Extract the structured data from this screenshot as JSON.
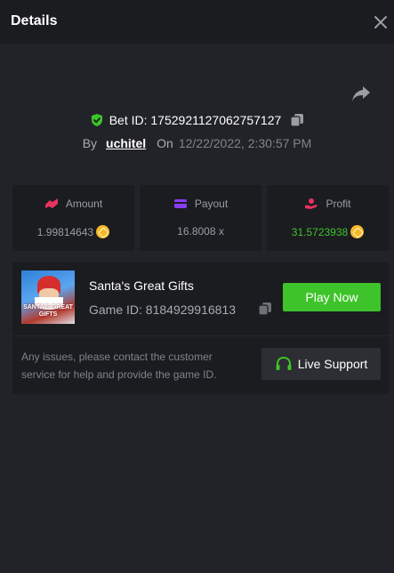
{
  "header": {
    "title": "Details",
    "close_icon": "close-icon"
  },
  "bet": {
    "id_label": "Bet ID: 1752921127062757127",
    "by_label": "By",
    "user": "uchitel",
    "on_label": "On",
    "date": "12/22/2022, 2:30:57 PM"
  },
  "stats": [
    {
      "label": "Amount",
      "value": "1.99814643",
      "icon": "amount-icon",
      "currency_icon": "coin-icon"
    },
    {
      "label": "Payout",
      "value": "16.8008 x",
      "icon": "card-icon"
    },
    {
      "label": "Profit",
      "value": "31.5723938",
      "icon": "profit-icon",
      "currency_icon": "coin-icon"
    }
  ],
  "game": {
    "name": "Santa's Great Gifts",
    "game_id": "Game ID: 8184929916813",
    "thumb_text": "SANTA'S GREAT GIFTS",
    "play_label": "Play Now"
  },
  "support": {
    "issues_text": "Any issues, please contact the customer service for help and provide the game ID.",
    "button_label": "Live Support"
  },
  "colors": {
    "background": "#222328",
    "panel": "#1b1c20",
    "accent_green": "#3ec32a",
    "amount_icon": "#e8335f",
    "payout_icon": "#8a3cf0",
    "profit_icon": "#e8335f",
    "coin": "#f6b826"
  }
}
